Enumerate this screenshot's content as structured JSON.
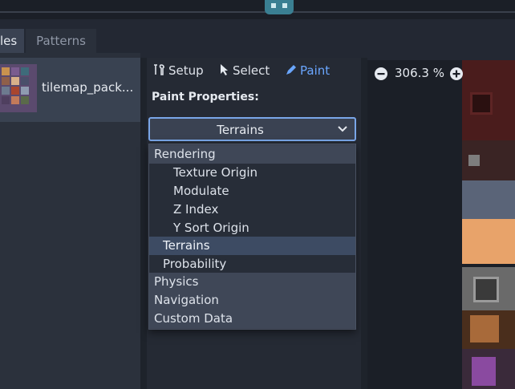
{
  "tabs": [
    {
      "label": "les"
    },
    {
      "label": "Patterns"
    }
  ],
  "atlas": {
    "name": "tilemap_pack..."
  },
  "toolbar": {
    "setup_label": "Setup",
    "select_label": "Select",
    "paint_label": "Paint"
  },
  "paint_properties_label": "Paint Properties:",
  "dropdown": {
    "selected": "Terrains"
  },
  "popup_items": [
    {
      "label": "Rendering",
      "kind": "section"
    },
    {
      "label": "Texture Origin",
      "kind": "sub"
    },
    {
      "label": "Modulate",
      "kind": "sub"
    },
    {
      "label": "Z Index",
      "kind": "sub"
    },
    {
      "label": "Y Sort Origin",
      "kind": "sub"
    },
    {
      "label": "Terrains",
      "kind": "selected"
    },
    {
      "label": "Probability",
      "kind": "sub"
    },
    {
      "label": "Physics",
      "kind": "section"
    },
    {
      "label": "Navigation",
      "kind": "section"
    },
    {
      "label": "Custom Data",
      "kind": "section"
    }
  ],
  "zoom": {
    "label": "306.3 %"
  },
  "colors": {
    "accent": "#6aa6ff",
    "dropdown_border": "#7aa6e8",
    "selected_item": "#3d4b63"
  },
  "icons": [
    "wrench-screwdriver-icon",
    "cursor-icon",
    "pencil-icon",
    "chevron-down-icon",
    "zoom-out-icon",
    "zoom-in-icon"
  ]
}
